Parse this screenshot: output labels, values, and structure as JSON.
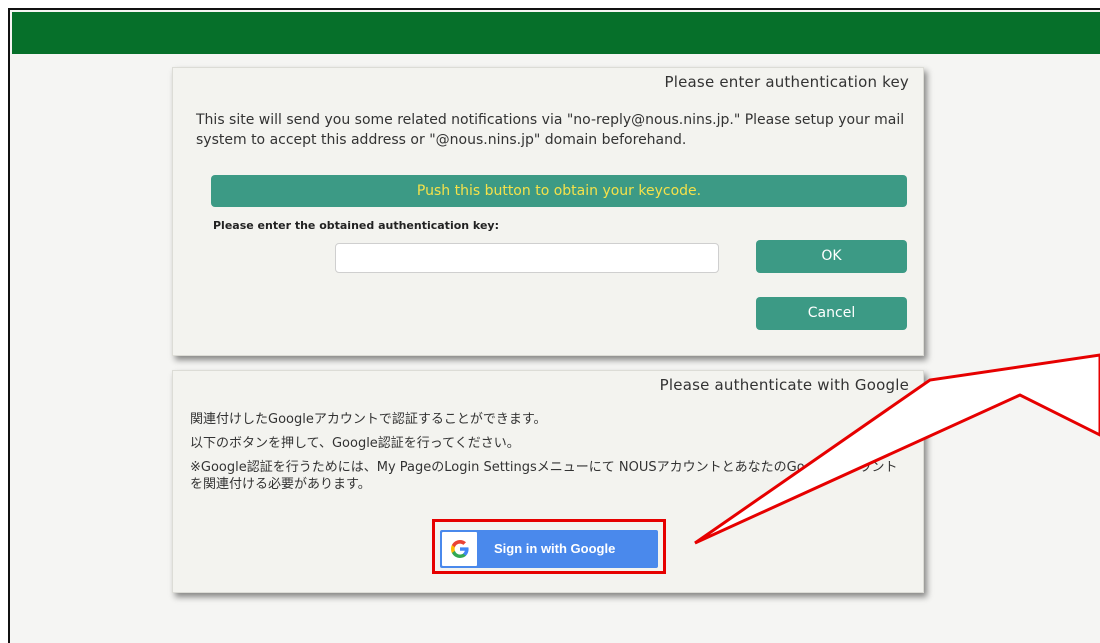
{
  "auth_panel": {
    "title": "Please enter authentication key",
    "notice": "This site will send you some related notifications via \"no-reply@nous.nins.jp.\" Please setup your mail system to accept this address or \"@nous.nins.jp\" domain beforehand.",
    "obtain_button_label": "Push this button to obtain your keycode.",
    "key_label": "Please enter the obtained authentication key:",
    "key_input_value": "",
    "ok_label": "OK",
    "cancel_label": "Cancel"
  },
  "google_panel": {
    "title": "Please authenticate with Google",
    "line1": "関連付けしたGoogleアカウントで認証することができます。",
    "line2": "以下のボタンを押して、Google認証を行ってください。",
    "line3": "※Google認証を行うためには、My PageのLogin Settingsメニューにて NOUSアカウントとあなたのGoogleアカウントを関連付ける必要があります。",
    "signin_label": "Sign in with Google"
  },
  "colors": {
    "topbar": "#06702a",
    "panel_button": "#3c9a85",
    "obtain_text": "#f5e14a",
    "google_blue": "#4a89ec",
    "highlight_red": "#e60000"
  },
  "icons": {
    "google": "google-g-icon"
  }
}
